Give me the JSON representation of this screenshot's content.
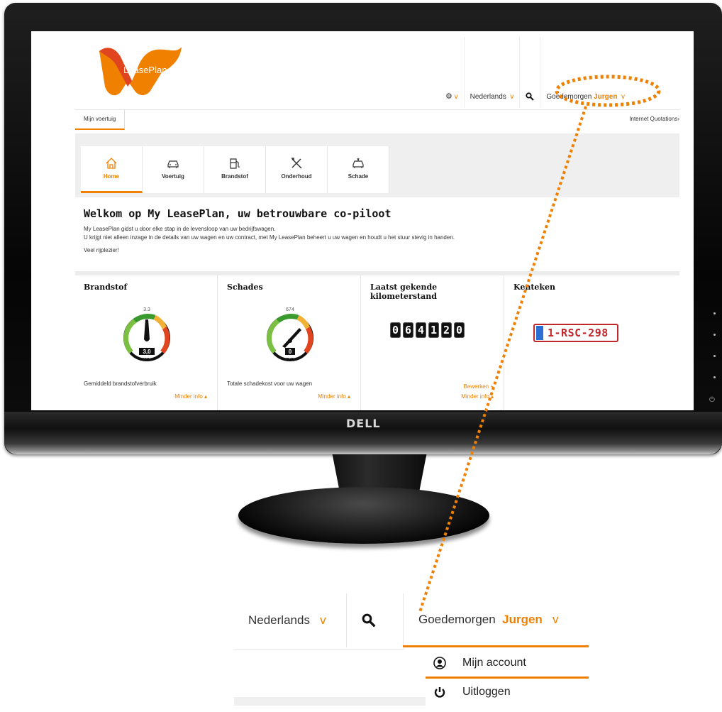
{
  "monitor": {
    "brand": "DELL"
  },
  "header": {
    "logo_text": "LeasePlan",
    "settings_chevron": "v",
    "language": "Nederlands",
    "language_chevron": "v",
    "greeting": "Goedemorgen",
    "user_name": "Jurgen",
    "user_chevron": "v"
  },
  "tabbar": {
    "my_vehicle": "Mijn voertuig",
    "quotations": "Internet Quotations›"
  },
  "nav_tiles": [
    {
      "label": "Home",
      "icon": "home-icon"
    },
    {
      "label": "Voertuig",
      "icon": "car-icon"
    },
    {
      "label": "Brandstof",
      "icon": "fuel-pump-icon"
    },
    {
      "label": "Onderhoud",
      "icon": "tools-icon"
    },
    {
      "label": "Schade",
      "icon": "damaged-car-icon"
    }
  ],
  "welcome": {
    "title": "Welkom op My LeasePlan, uw betrouwbare co-piloot",
    "line1": "My LeasePlan gidst u door elke stap in de levensloop van uw bedrijfswagen.",
    "line2": "U krijgt niet alleen inzage in de details van uw wagen en uw contract, met My LeasePlan beheert u uw wagen en houdt u het stuur stevig in handen.",
    "line3": "Veel rijplezier!"
  },
  "widgets": {
    "fuel": {
      "title": "Brandstof",
      "gauge_max_label": "3.3",
      "value": "3,0",
      "unit": "l/100km",
      "caption": "Gemiddeld brandstofverbruik",
      "link": "Minder info ▴"
    },
    "damage": {
      "title": "Schades",
      "gauge_max_label": "674",
      "value": "0",
      "unit": "EUR",
      "caption": "Totale schadekost voor uw wagen",
      "link": "Minder info ▴"
    },
    "mileage": {
      "title": "Laatst gekende kilometerstand",
      "digits": [
        "0",
        "6",
        "4",
        "1",
        "2",
        "0"
      ],
      "edit_link": "Bewerken +",
      "link": "Minder info ▴"
    },
    "plate": {
      "title": "Kenteken",
      "plate_number": "1-RSC-298"
    }
  },
  "zoom": {
    "language": "Nederlands",
    "language_chevron": "v",
    "greeting": "Goedemorgen",
    "user_name": "Jurgen",
    "user_chevron": "v",
    "menu": [
      {
        "label": "Mijn account",
        "icon": "user-circle-icon"
      },
      {
        "label": "Uitloggen",
        "icon": "power-icon"
      }
    ]
  },
  "colors": {
    "accent": "#f08000",
    "plate_red": "#c0282c",
    "eu_blue": "#2b6fd4"
  }
}
